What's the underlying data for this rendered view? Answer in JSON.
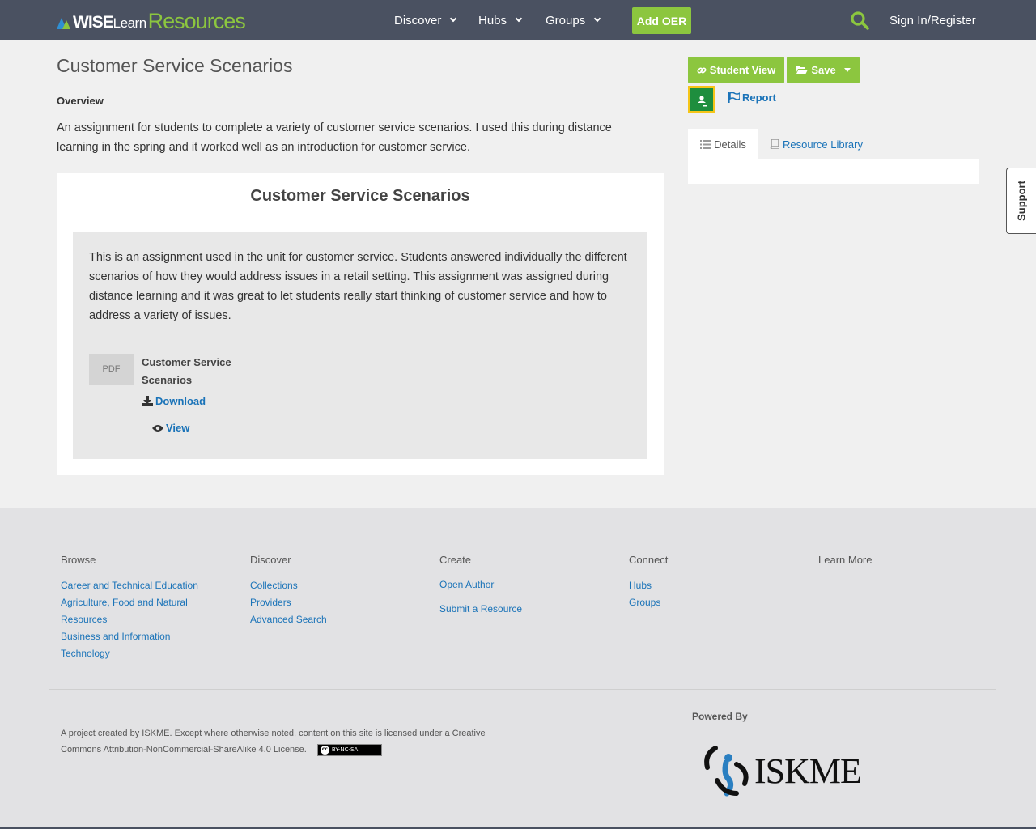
{
  "header": {
    "logo": {
      "part1": "WISE",
      "part2": "Learn",
      "part3": "Resources"
    },
    "nav": [
      {
        "label": "Discover"
      },
      {
        "label": "Hubs"
      },
      {
        "label": "Groups"
      }
    ],
    "add_oer": "Add OER",
    "sign_in": "Sign In/Register"
  },
  "resource": {
    "title": "Customer Service Scenarios",
    "overview_label": "Overview",
    "overview_text": "An assignment for students to complete a variety of customer service scenarios.  I used this during distance learning in the spring and it worked well as an introduction for customer service.",
    "card_title": "Customer Service Scenarios",
    "description": "This is an assignment used in the unit for customer service.  Students answered individually the different scenarios of how they would address issues in a retail setting.  This assignment was assigned during distance learning and it was great to let students really start thinking of customer service and how to address a variety of issues.",
    "file": {
      "type": "PDF",
      "name": "Customer Service Scenarios",
      "download": "Download",
      "view": "View"
    }
  },
  "sidebar": {
    "student_view": "Student View",
    "save": "Save",
    "report": "Report",
    "tabs": [
      {
        "label": "Details"
      },
      {
        "label": "Resource Library"
      }
    ]
  },
  "support": "Support",
  "footer": {
    "browse": {
      "heading": "Browse",
      "links": [
        "Career and Technical Education",
        "Agriculture, Food and Natural Resources",
        "Business and Information Technology"
      ]
    },
    "discover": {
      "heading": "Discover",
      "links": [
        "Collections",
        "Providers",
        "Advanced Search"
      ]
    },
    "create": {
      "heading": "Create",
      "links": [
        "Open Author",
        "Submit a Resource"
      ]
    },
    "connect": {
      "heading": "Connect",
      "links": [
        "Hubs",
        "Groups"
      ]
    },
    "learn_more": {
      "heading": "Learn More"
    },
    "license": "A project created by ISKME. Except where otherwise noted, content on this site is licensed under a Creative Commons Attribution-NonCommercial-ShareAlike 4.0 License.",
    "cc_badge": "BY-NC-SA",
    "powered_by": "Powered By",
    "iskme_logo": "ISKME"
  },
  "colors": {
    "header_bg": "#4a5161",
    "accent_green": "#8cc63f",
    "link_blue": "#1a73b8",
    "page_bg": "#f0f0f0",
    "footer_bg": "#e2e2e4"
  },
  "icons": [
    "search-icon",
    "chevron-down-icon",
    "link-icon",
    "folder-open-icon",
    "caret-down-icon",
    "google-classroom-icon",
    "flag-icon",
    "list-icon",
    "book-icon",
    "download-icon",
    "eye-icon",
    "cc-icon"
  ]
}
